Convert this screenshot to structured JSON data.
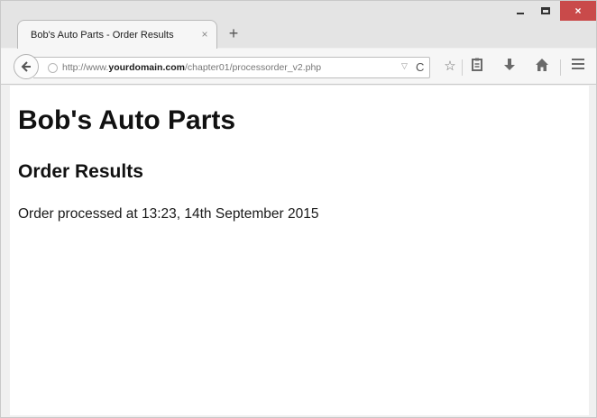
{
  "browser": {
    "tab_title": "Bob's Auto Parts - Order Results",
    "tab_close": "×",
    "new_tab": "+",
    "window": {
      "minimize": "",
      "maximize": "",
      "close": "×"
    },
    "url": {
      "prefix": "http://www.",
      "domain": "yourdomain.com",
      "path": "/chapter01/processorder_v2.php",
      "dropdown_glyph": "▽",
      "reload_glyph": "C"
    },
    "icons": [
      "back-arrow-icon",
      "globe-icon",
      "star-icon",
      "clipboard-icon",
      "download-icon",
      "home-icon",
      "menu-icon"
    ]
  },
  "page": {
    "heading": "Bob's Auto Parts",
    "subheading": "Order Results",
    "message": "Order processed at 13:23, 14th September 2015"
  }
}
